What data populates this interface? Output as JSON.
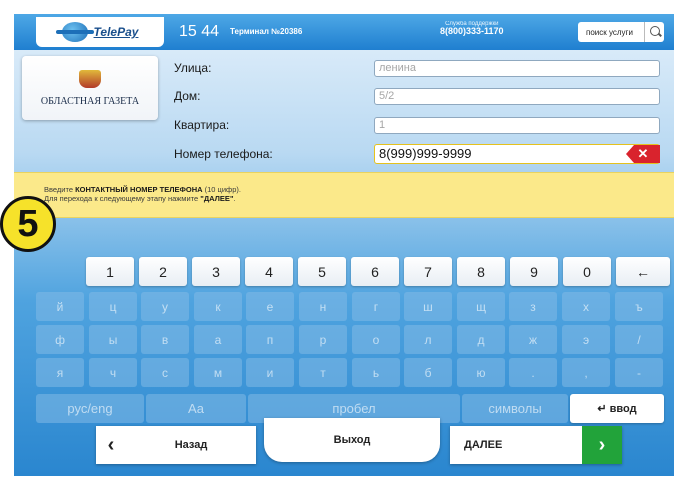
{
  "header": {
    "logo_text": "TelePay",
    "clock": "15 44",
    "terminal": "Терминал №20386",
    "support_label": "Служба поддержки",
    "support_phone": "8(800)333-1170",
    "search_label": "поиск услуги"
  },
  "provider": {
    "name": "ОБЛАСТНАЯ ГАЗЕТА"
  },
  "form": {
    "street": {
      "label": "Улица:",
      "value": "ленина"
    },
    "house": {
      "label": "Дом:",
      "value": "5/2"
    },
    "flat": {
      "label": "Квартира:",
      "value": "1"
    },
    "phone": {
      "label": "Номер телефона:",
      "value": "8(999)999-9999",
      "clear": "✕"
    }
  },
  "hint": {
    "prefix": "Введите ",
    "bold": "КОНТАКТНЫЙ НОМЕР ТЕЛЕФОНА",
    "suffix": " (10 цифр).",
    "line2_prefix": "Для перехода к следующему этапу нажмите ",
    "line2_bold": "\"ДАЛЕЕ\"",
    "line2_suffix": "."
  },
  "step_badge": "5",
  "keyboard": {
    "numbers": [
      "1",
      "2",
      "3",
      "4",
      "5",
      "6",
      "7",
      "8",
      "9",
      "0",
      "←"
    ],
    "row1": [
      "й",
      "ц",
      "у",
      "к",
      "е",
      "н",
      "г",
      "ш",
      "щ",
      "з",
      "х",
      "ъ"
    ],
    "row2": [
      "ф",
      "ы",
      "в",
      "а",
      "п",
      "р",
      "о",
      "л",
      "д",
      "ж",
      "э",
      "/"
    ],
    "row3": [
      "я",
      "ч",
      "с",
      "м",
      "и",
      "т",
      "ь",
      "б",
      "ю",
      ".",
      ",",
      "-"
    ],
    "lang": "рус/eng",
    "case": "Аа",
    "space": "пробел",
    "symbols": "символы",
    "enter": "↵ ввод"
  },
  "nav": {
    "back": "Назад",
    "back_arrow": "‹",
    "exit": "Выход",
    "next": "ДАЛЕЕ",
    "next_arrow": "›"
  },
  "colors": {
    "accent_blue": "#1f7fd0",
    "hint_yellow": "#fbe98a",
    "next_green": "#22a33a",
    "clear_red": "#d9232d"
  }
}
